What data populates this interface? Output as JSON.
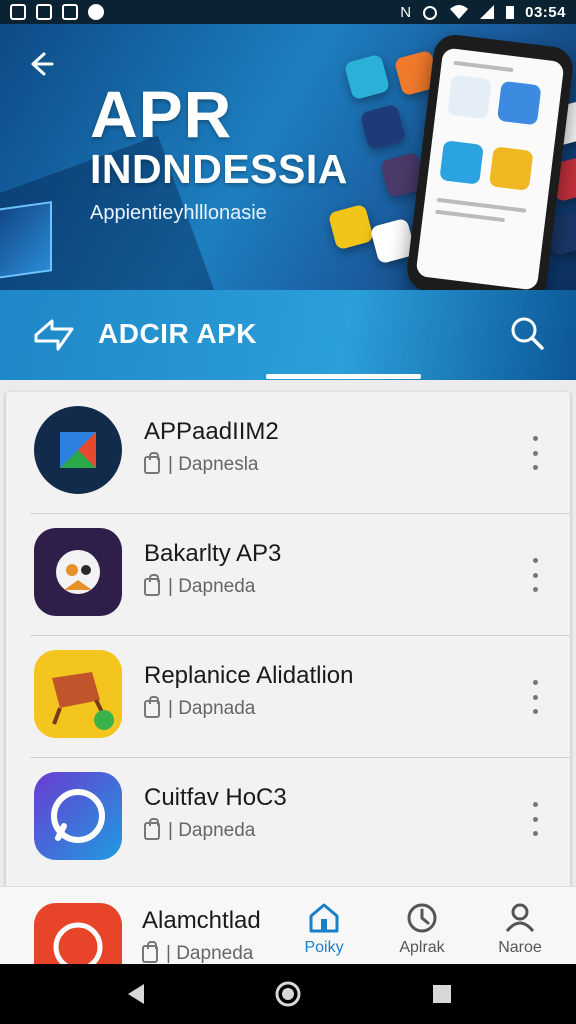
{
  "status_bar": {
    "time": "03:54",
    "carrier": "N"
  },
  "hero": {
    "title_line1": "APR",
    "title_line2": "INDNDESSIA",
    "subtitle": "Appientieyhlllonasie"
  },
  "tab_bar": {
    "title": "ADCIR APK"
  },
  "apps": [
    {
      "name": "APPaadIIM2",
      "meta": "| Dapnesla"
    },
    {
      "name": "Bakarlty AP3",
      "meta": "| Dapneda"
    },
    {
      "name": "Replanice Alidatlion",
      "meta": "| Dapnada"
    },
    {
      "name": "Cuitfav HoC3",
      "meta": "| Dapneda"
    },
    {
      "name": "Alamchtlad",
      "meta": "| Dapneda"
    }
  ],
  "bottom_nav": [
    {
      "label": "Poiky",
      "icon": "home-icon"
    },
    {
      "label": "Aplrak",
      "icon": "clock-icon"
    },
    {
      "label": "Naroe",
      "icon": "person-icon"
    }
  ],
  "colors": {
    "accent": "#1a7fc6",
    "header": "#1d7fc0"
  }
}
